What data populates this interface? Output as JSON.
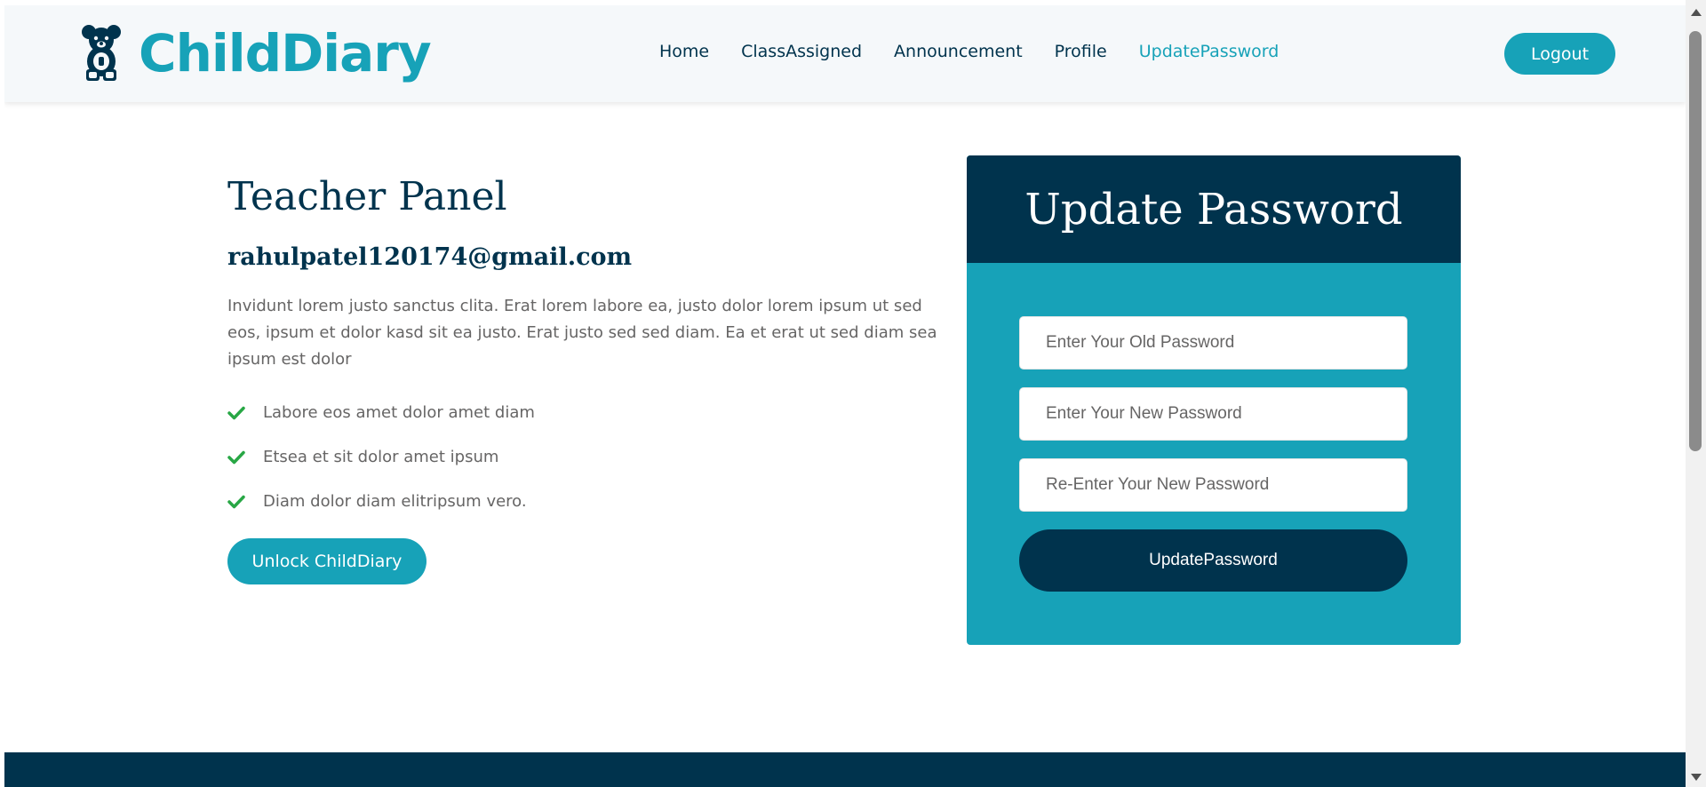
{
  "brand": {
    "name": "ChildDiary",
    "icon": "teddy-bear-icon"
  },
  "nav": {
    "links": [
      "Home",
      "ClassAssigned",
      "Announcement",
      "Profile",
      "UpdatePassword"
    ],
    "active": "UpdatePassword",
    "logout_label": "Logout"
  },
  "main": {
    "title": "Teacher Panel",
    "email": "rahulpatel120174@gmail.com",
    "description": "Invidunt lorem justo sanctus clita. Erat lorem labore ea, justo dolor lorem ipsum ut sed eos, ipsum et dolor kasd sit ea justo. Erat justo sed sed diam. Ea et erat ut sed diam sea ipsum est dolor",
    "features": [
      "Labore eos amet dolor amet diam",
      "Etsea et sit dolor amet ipsum",
      "Diam dolor diam elitripsum vero."
    ],
    "unlock_button": "Unlock ChildDiary"
  },
  "form": {
    "title": "Update Password",
    "old_password_placeholder": "Enter Your Old Password",
    "new_password_placeholder": "Enter Your New Password",
    "confirm_password_placeholder": "Re-Enter Your New Password",
    "submit_label": "UpdatePassword"
  },
  "colors": {
    "primary": "#17a2b8",
    "dark": "#00334d",
    "text": "#666565",
    "check": "#28a745",
    "navbar_bg": "#f5f8fa"
  }
}
